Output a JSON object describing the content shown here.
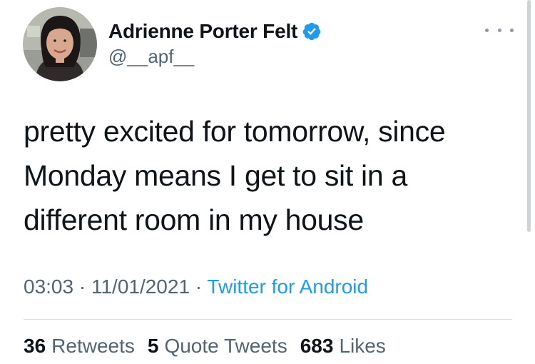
{
  "author": {
    "display_name": "Adrienne Porter Felt",
    "handle": "@__apf__",
    "verified": true
  },
  "tweet": {
    "text": "pretty excited for tomorrow, since Monday means I get to sit in a different room in my house"
  },
  "meta": {
    "time": "03:03",
    "separator": " · ",
    "date": "11/01/2021",
    "source": "Twitter for Android"
  },
  "stats": {
    "retweets_count": "36",
    "retweets_label": "Retweets",
    "quote_count": "5",
    "quote_label": "Quote Tweets",
    "likes_count": "683",
    "likes_label": "Likes"
  },
  "colors": {
    "link": "#1d9bf0",
    "secondary_text": "#536471",
    "primary_text": "#0f1419",
    "verified_badge": "#1d9bf0"
  },
  "icons": {
    "verified": "verified-badge-icon",
    "more": "more-options-icon"
  }
}
